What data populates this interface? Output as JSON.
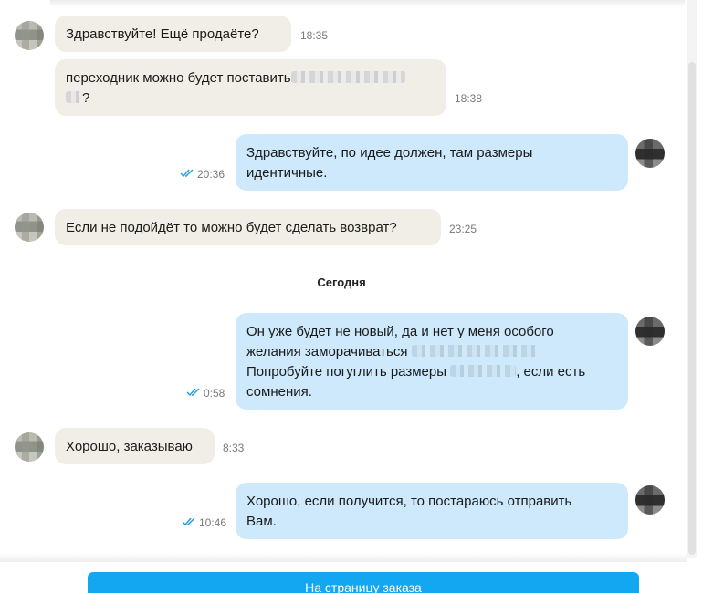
{
  "messages": [
    {
      "id": "m1",
      "direction": "incoming",
      "text": "Здравствуйте! Ещё продаёте?",
      "time": "18:35"
    },
    {
      "id": "m2",
      "direction": "incoming",
      "text_before": "переходник можно будет поставить",
      "text_after": "?",
      "time": "18:38"
    },
    {
      "id": "m3",
      "direction": "outgoing",
      "text_line1": "Здравствуйте, по идее должен, там размеры",
      "text_line2": "идентичные.",
      "time": "20:36",
      "read": true
    },
    {
      "id": "m4",
      "direction": "incoming",
      "text": "Если не подойдёт то можно будет сделать возврат?",
      "time": "23:25"
    },
    {
      "id": "m5",
      "direction": "outgoing",
      "text_line1": "Он уже будет не новый, да и нет у меня особого",
      "text_line2": "желания заморачиваться",
      "text_line3": "Попробуйте погуглить размеры",
      "text_line3_after": ", если есть",
      "text_line4": "сомнения.",
      "time": "0:58",
      "read": true
    },
    {
      "id": "m6",
      "direction": "incoming",
      "text": "Хорошо, заказываю",
      "time": "8:33"
    },
    {
      "id": "m7",
      "direction": "outgoing",
      "text_line1": "Хорошо, если получится, то постараюсь отправить",
      "text_line2": "Вам.",
      "time": "10:46",
      "read": true
    }
  ],
  "date_separator": "Сегодня",
  "order_button_label": "На страницу заказа",
  "colors": {
    "incoming_bubble": "#f1eee7",
    "outgoing_bubble": "#cde9fb",
    "read_check": "#1a9be8",
    "button": "#12a7f0"
  }
}
